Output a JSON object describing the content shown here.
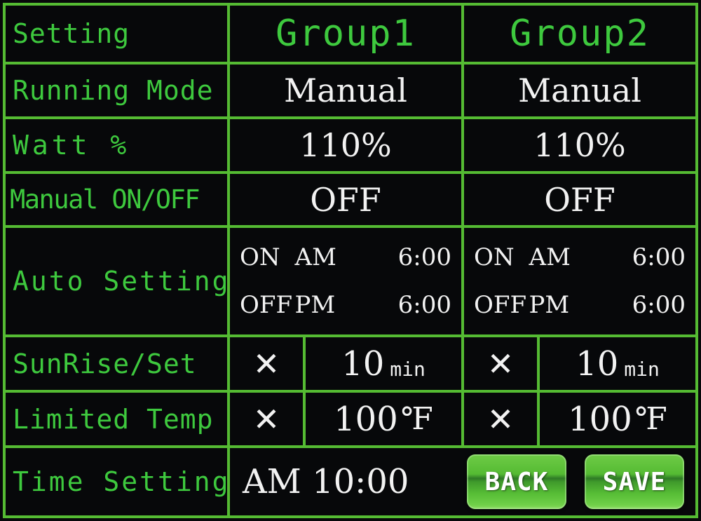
{
  "screen": {
    "title": "Lighting Controller Setting Screen",
    "colors": {
      "background": "#07080a",
      "grid_line": "#55bb33",
      "label_text": "#3ec93e",
      "value_text": "#f2f2f2",
      "button_green": "#55bb33"
    }
  },
  "table": {
    "header": {
      "label": "Setting",
      "group1": "Group1",
      "group2": "Group2"
    },
    "rows": [
      {
        "label": "Running Mode",
        "group1": "Manual",
        "group2": "Manual"
      },
      {
        "label": "Watt %",
        "group1": "110%",
        "group2": "110%"
      },
      {
        "label": "Manual ON/OFF",
        "group1": "OFF",
        "group2": "OFF"
      }
    ],
    "auto_setting": {
      "label": "Auto Setting",
      "group1": {
        "on_state": "ON",
        "on_meridiem": "AM",
        "on_time": "6:00",
        "off_state": "OFF",
        "off_meridiem": "PM",
        "off_time": "6:00"
      },
      "group2": {
        "on_state": "ON",
        "on_meridiem": "AM",
        "on_time": "6:00",
        "off_state": "OFF",
        "off_meridiem": "PM",
        "off_time": "6:00"
      }
    },
    "sunrise_set": {
      "label": "SunRise/Set",
      "group1": {
        "toggle": "✕",
        "value": "10",
        "unit": "min"
      },
      "group2": {
        "toggle": "✕",
        "value": "10",
        "unit": "min"
      }
    },
    "limited_temp": {
      "label": "Limited Temp",
      "group1": {
        "toggle": "✕",
        "value": "100",
        "unit": "℉"
      },
      "group2": {
        "toggle": "✕",
        "value": "100",
        "unit": "℉"
      }
    },
    "time_setting": {
      "label": "Time Setting",
      "value": "AM 10:00",
      "back_button": "BACK",
      "save_button": "SAVE"
    }
  }
}
